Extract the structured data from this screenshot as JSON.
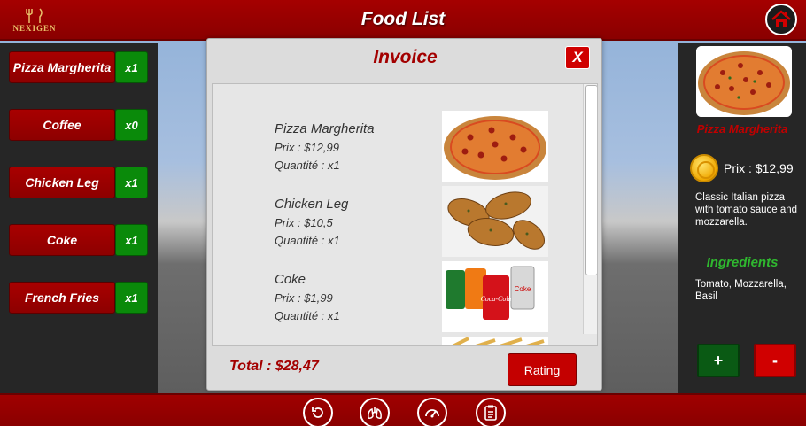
{
  "header": {
    "logo_text": "NEXIGEN",
    "title": "Food List",
    "home_icon": "home-icon"
  },
  "food_list": [
    {
      "name": "Pizza Margherita",
      "qty": "x1"
    },
    {
      "name": "Coffee",
      "qty": "x0"
    },
    {
      "name": "Chicken Leg",
      "qty": "x1"
    },
    {
      "name": "Coke",
      "qty": "x1"
    },
    {
      "name": "French Fries",
      "qty": "x1"
    }
  ],
  "invoice": {
    "title": "Invoice",
    "close_label": "X",
    "items": [
      {
        "name": "Pizza Margherita",
        "price": "Prix : $12,99",
        "qty": "Quantité : x1",
        "image": "pizza"
      },
      {
        "name": "Chicken Leg",
        "price": "Prix : $10,5",
        "qty": "Quantité : x1",
        "image": "chicken-leg"
      },
      {
        "name": "Coke",
        "price": "Prix : $1,99",
        "qty": "Quantité : x1",
        "image": "soda-cans"
      }
    ],
    "total": "Total : $28,47",
    "rating_label": "Rating"
  },
  "detail": {
    "name": "Pizza Margherita",
    "price": "Prix : $12,99",
    "description": "Classic Italian pizza with tomato sauce and mozzarella.",
    "ingredients_title": "Ingredients",
    "ingredients": "Tomato, Mozzarella, Basil",
    "plus_label": "+",
    "minus_label": "-"
  },
  "bottom_nav": [
    "back-icon",
    "lungs-icon",
    "gauge-icon",
    "clipboard-icon"
  ],
  "colors": {
    "brand_red": "#a50000",
    "qty_green": "#0a8a0a",
    "panel_dark": "#262626",
    "ingredients_green": "#2fb82f"
  }
}
